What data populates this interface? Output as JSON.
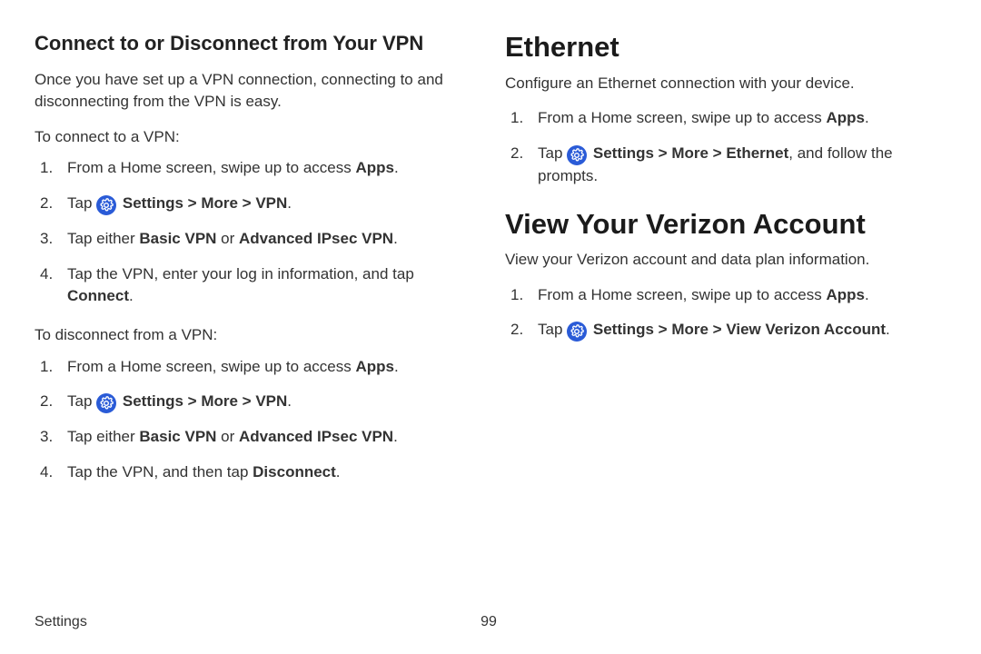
{
  "left": {
    "subhead": "Connect to or Disconnect from Your VPN",
    "intro": "Once you have set up a VPN connection, connecting to and disconnecting from the VPN is easy.",
    "connect_label": "To connect to a VPN:",
    "connect_steps": {
      "s1_a": "From a Home screen, swipe up to access ",
      "s1_b": "Apps",
      "s1_c": ".",
      "s2_a": "Tap ",
      "s2_b": "Settings",
      "s2_c": " > ",
      "s2_d": "More",
      "s2_e": " > ",
      "s2_f": "VPN",
      "s2_g": ".",
      "s3_a": "Tap either ",
      "s3_b": "Basic VPN",
      "s3_c": " or ",
      "s3_d": "Advanced IPsec VPN",
      "s3_e": ".",
      "s4_a": "Tap the VPN, enter your log in information, and tap ",
      "s4_b": "Connect",
      "s4_c": "."
    },
    "disconnect_label": "To disconnect from a VPN:",
    "disconnect_steps": {
      "s1_a": "From a Home screen, swipe up to access ",
      "s1_b": "Apps",
      "s1_c": ".",
      "s2_a": "Tap ",
      "s2_b": "Settings",
      "s2_c": " > ",
      "s2_d": "More",
      "s2_e": " > ",
      "s2_f": "VPN",
      "s2_g": ".",
      "s3_a": "Tap either ",
      "s3_b": "Basic VPN",
      "s3_c": " or ",
      "s3_d": "Advanced IPsec VPN",
      "s3_e": ".",
      "s4_a": "Tap the VPN, and then tap ",
      "s4_b": "Disconnect",
      "s4_c": "."
    }
  },
  "right": {
    "ethernet_head": "Ethernet",
    "ethernet_intro": "Configure an Ethernet connection with your device.",
    "ethernet_steps": {
      "s1_a": "From a Home screen, swipe up to access ",
      "s1_b": "Apps",
      "s1_c": ".",
      "s2_a": "Tap ",
      "s2_b": "Settings",
      "s2_c": " > ",
      "s2_d": "More",
      "s2_e": " > ",
      "s2_f": "Ethernet",
      "s2_g": ", and follow the prompts."
    },
    "verizon_head": "View Your Verizon Account",
    "verizon_intro": "View your Verizon account and data plan information.",
    "verizon_steps": {
      "s1_a": "From a Home screen, swipe up to access ",
      "s1_b": "Apps",
      "s1_c": ".",
      "s2_a": "Tap ",
      "s2_b": "Settings",
      "s2_c": " > ",
      "s2_d": "More",
      "s2_e": " > ",
      "s2_f": "View Verizon Account",
      "s2_g": "."
    }
  },
  "footer": {
    "section": "Settings",
    "page": "99"
  }
}
